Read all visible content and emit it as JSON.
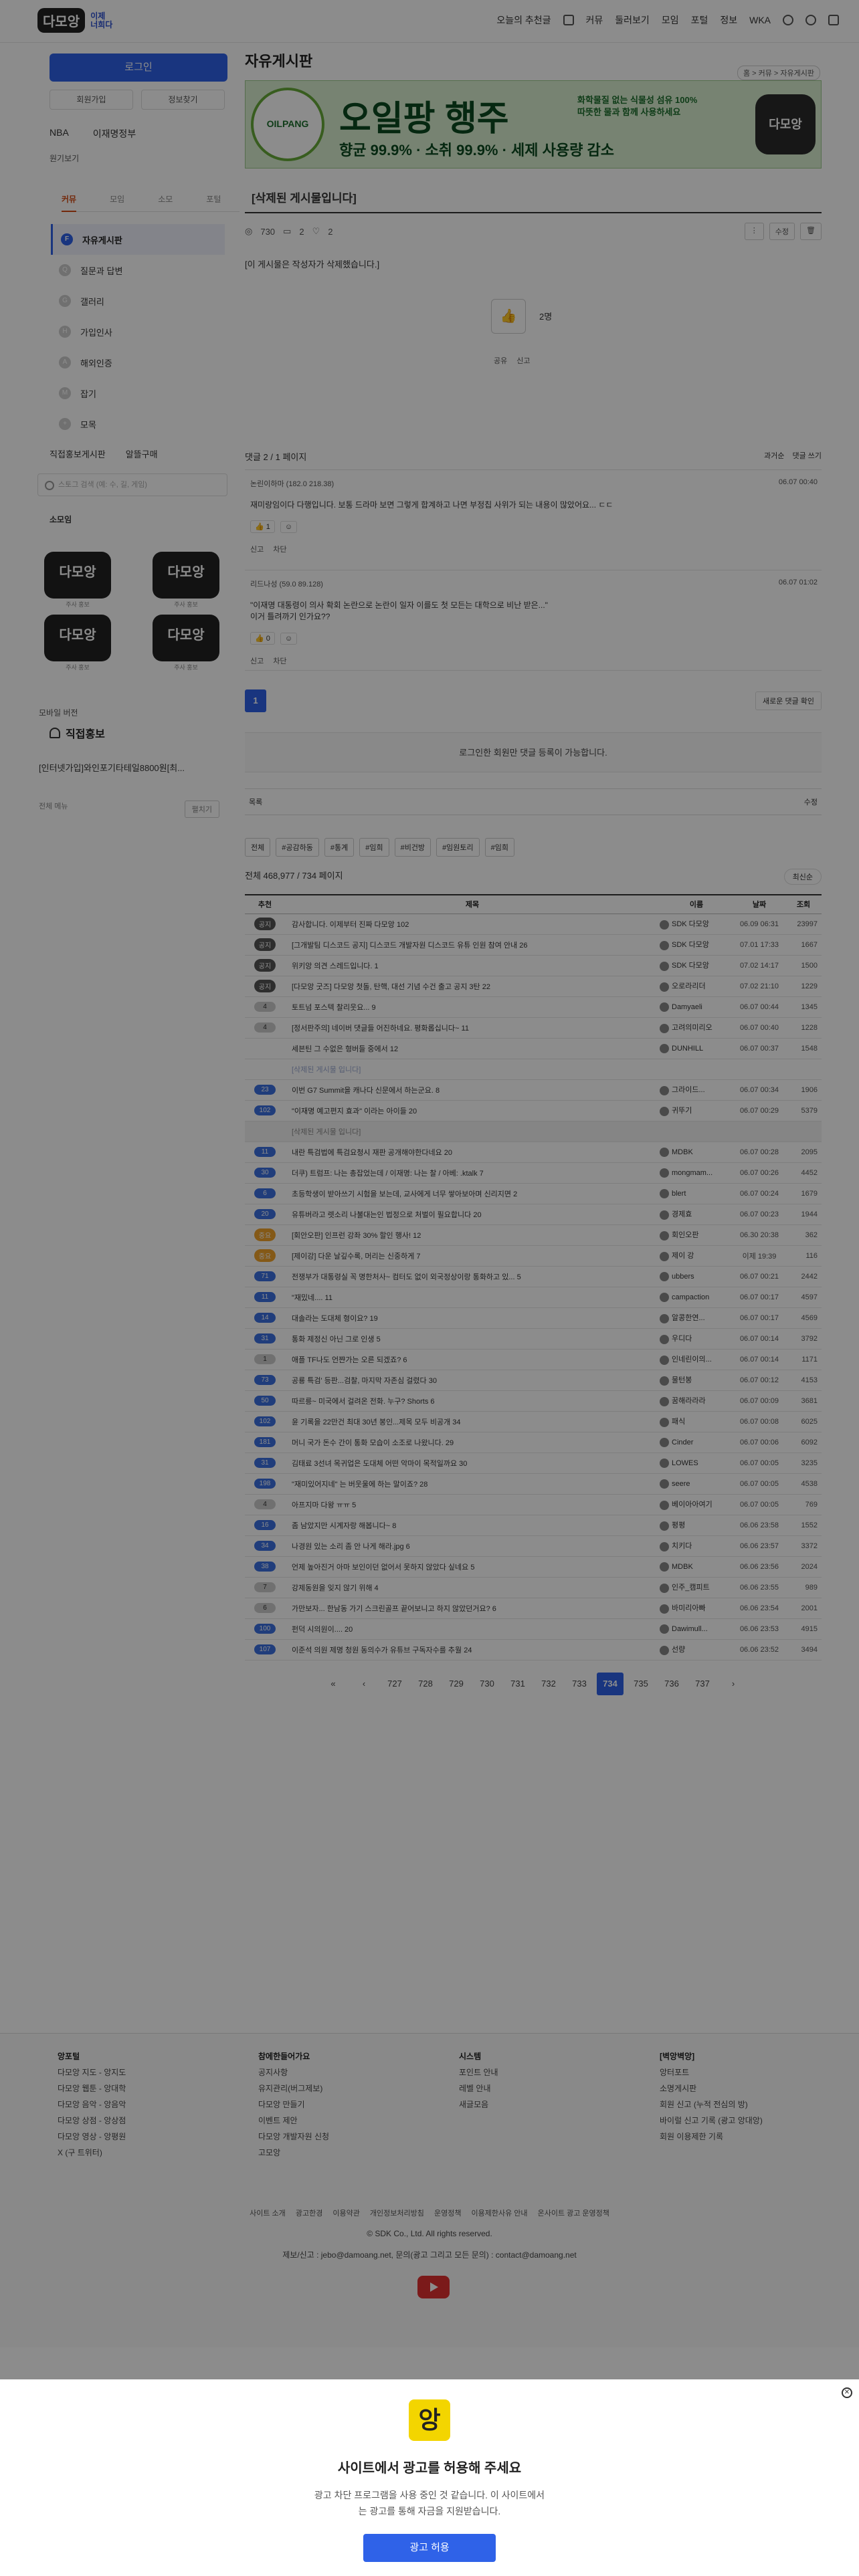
{
  "header": {
    "logo_text": "다모앙",
    "logo_sub": "이제\n너희다",
    "nav": [
      "오늘의 추천글",
      "커뮤",
      "둘러보기",
      "모임",
      "포털",
      "정보",
      "WKA"
    ]
  },
  "sidebar": {
    "login_label": "로그인",
    "join_label": "회원가입",
    "find_label": "정보찾기",
    "link1": "NBA",
    "link2": "이재명정부",
    "recent_label": "원기보기",
    "tabs": [
      "커뮤",
      "모임",
      "소모",
      "포털"
    ],
    "menu": [
      {
        "label": "자유게시판",
        "dot": "F"
      },
      {
        "label": "질문과 답변",
        "dot": "Q"
      },
      {
        "label": "갤러리",
        "dot": "G"
      },
      {
        "label": "가입인사",
        "dot": "H"
      },
      {
        "label": "해외인증",
        "dot": "A"
      },
      {
        "label": "잡기",
        "dot": "M"
      },
      {
        "label": "모목",
        "dot": "+"
      }
    ],
    "shop1": "직접홍보게시판",
    "shop2": "알뜰구매",
    "search_placeholder": "스토그 검색 (예: 수, 길, 게임)",
    "sub_label": "소모임",
    "stickers": [
      {
        "text": "다모앙",
        "cap": "주사 홍보"
      },
      {
        "text": "다모앙",
        "cap": "주사 홍보"
      },
      {
        "text": "다모앙",
        "cap": "주사 홍보"
      },
      {
        "text": "다모앙",
        "cap": "주사 홍보"
      }
    ],
    "mobile_label": "모바일 버전",
    "ad_title": "직접홍보",
    "ad_text": "[인터넷가입]와인포기타테일8800원[최...",
    "foot_left": "전체 메뉴",
    "foot_right": "펼치기"
  },
  "board": {
    "title": "자유게시판",
    "breadcrumb": "홈 > 커뮤 > 자유게시판",
    "banner": {
      "brand": "OILPANG",
      "headline": "오일팡 행주",
      "features": "향균 99.9% · 소취 99.9% · 세제 사용량 감소",
      "note": "화학물질 없는 식물성 섬유 100%\n따뜻한 물과 함께 사용하세요",
      "logo2": "다모앙"
    },
    "post_title": "[삭제된 게시물입니다]",
    "views": "730",
    "comments": "2",
    "likes": "2",
    "edit_label": "수정",
    "body": "[이 게시물은 작성자가 삭제했습니다.]",
    "vote_count": "2명",
    "share_label": "공유",
    "report_label": "신고"
  },
  "comments": {
    "header": "댓글 2 / 1 페이지",
    "sort_label": "과거순",
    "write_label": "댓글 쓰기",
    "items": [
      {
        "who": "논린이하마 (182.0 218.38)",
        "time": "06.07 00:40",
        "text": "재미랑임이다 다행입니다. 보통 드라마 보면 그렇게 합계하고 나면 부정칩 사위가 되는 내용이 많았어요... ㄷㄷ",
        "likes": "1",
        "report": "신고",
        "block": "차단"
      },
      {
        "who": "리드나성 (59.0 89.128)",
        "time": "06.07 01:02",
        "text": "\"이재명 대통령이 의사 확회 논란으로 논란이 일자 이를도 첫 모든는 대학으로 비난 받은...\"\n이거 틀려까기 인가요??",
        "likes": "0",
        "report": "신고",
        "block": "차단"
      }
    ],
    "page": "1",
    "new_check": "새로운 댓글 확인",
    "login_required": "로그인한 회원만 댓글 등록이 가능합니다."
  },
  "list": {
    "list_label": "목록",
    "chips": [
      "전체",
      "#공감하동",
      "#통계",
      "#임희",
      "#비건방",
      "#임원토리",
      "#임희"
    ],
    "total": "전체 468,977 / 734 페이지",
    "sort_label": "최신순",
    "columns": [
      "추천",
      "제목",
      "이름",
      "날짜",
      "조회"
    ],
    "rows": [
      {
        "num": "공지",
        "type": "notice",
        "title": "감사합니다. 이제부터 진짜 다모앙 102",
        "name": "SDK 다모앙",
        "date": "06.09 06:31",
        "view": "23997"
      },
      {
        "num": "공지",
        "type": "notice",
        "title": "[그개발팀 디스코드 공지] 디스코드 개발자원 디스코드 유튜 인원 참여 안내 26",
        "name": "SDK 다모앙",
        "date": "07.01 17:33",
        "view": "1667"
      },
      {
        "num": "공지",
        "type": "notice",
        "title": "위키앙 의견 스레드입니다. 1",
        "name": "SDK 다모앙",
        "date": "07.02 14:17",
        "view": "1500"
      },
      {
        "num": "공지",
        "type": "notice",
        "title": "[다모앙 굿즈] 다모앙 첫돌, 탄핵, 대선 기념 수건 출고 공지 3탄 22",
        "name": "오로라리더",
        "date": "07.02 21:10",
        "view": "1229"
      },
      {
        "num": "4",
        "type": "gray",
        "title": "토트넘 포스텍 찰리웃요... 9",
        "name": "Damyaeli",
        "date": "06.07 00:44",
        "view": "1345"
      },
      {
        "num": "4",
        "type": "gray",
        "title": "[정서판주의] 네이버 댓글들 어진하네요. 평화롭십니다~ 11",
        "name": "고려의미리오",
        "date": "06.07 00:40",
        "view": "1228"
      },
      {
        "num": "",
        "type": "gray",
        "title": "세븐틴 그 수없은 형버들 중에서 12",
        "name": "DUNHILL",
        "date": "06.07 00:37",
        "view": "1548"
      },
      {
        "num": "",
        "type": "deleted",
        "title": "[삭제된 게시물 입니다]",
        "name": "",
        "date": "",
        "view": ""
      },
      {
        "num": "23",
        "type": "blue",
        "title": "이번 G7 Summit을 캐나다 신문에서 하는군요. 8",
        "name": "그라이드...",
        "date": "06.07 00:34",
        "view": "1906"
      },
      {
        "num": "102",
        "type": "blue",
        "title": "\"이재명 예고편지 효과\" 이라는 아이들 20",
        "name": "귀뚜기",
        "date": "06.07 00:29",
        "view": "5379"
      },
      {
        "num": "",
        "type": "sep",
        "title": "[삭제된 게시물 입니다]",
        "name": "",
        "date": "",
        "view": ""
      },
      {
        "num": "11",
        "type": "blue",
        "title": "내란 특검법에 특검요청시 재판 공개해야한다네요 20",
        "name": "MDBK",
        "date": "06.07 00:28",
        "view": "2095"
      },
      {
        "num": "30",
        "type": "blue",
        "title": "더쿠) 트럼프: 나는 총잡었는데 / 이재명: 나는 찰 / 아베: .ktalk 7",
        "name": "mongmam...",
        "date": "06.07 00:26",
        "view": "4452"
      },
      {
        "num": "6",
        "type": "blue",
        "title": "초등학생이 받아쓰기 시험을 보는데, 교사에게 너무 쌓아보아며 신리지면 2",
        "name": "blert",
        "date": "06.07 00:24",
        "view": "1679"
      },
      {
        "num": "20",
        "type": "blue",
        "title": "유튜버라고 렛소리 나불대는인 법정으로 처벌이 필요합니다 20",
        "name": "경제효",
        "date": "06.07 00:23",
        "view": "1944"
      },
      {
        "num": "중요",
        "type": "orange",
        "title": "[회안오판] 인프런 강좌 30% 할인 행사! 12",
        "name": "회인오판",
        "date": "06.30 20:38",
        "view": "362"
      },
      {
        "num": "중요",
        "type": "orange",
        "title": "[제이강] 다운 날깊수록, 머리는 신중하게 7",
        "name": "제이 강",
        "date": "이제 19:39",
        "view": "116"
      },
      {
        "num": "71",
        "type": "blue",
        "title": "전쟁부가 대통령실 꼭 명한처사~ 컴터도 없이 외국정상이랑 통화하고 있... 5",
        "name": "ubbers",
        "date": "06.07 00:21",
        "view": "2442"
      },
      {
        "num": "11",
        "type": "blue",
        "title": "\"재밌네.... 11",
        "name": "campaction",
        "date": "06.07 00:17",
        "view": "4597"
      },
      {
        "num": "14",
        "type": "blue",
        "title": "대솔라는 도대체 형이요? 19",
        "name": "알콩한연...",
        "date": "06.07 00:17",
        "view": "4569"
      },
      {
        "num": "31",
        "type": "blue",
        "title": "통화 제정신 아닌 그로 인생 5",
        "name": "우디다",
        "date": "06.07 00:14",
        "view": "3792"
      },
      {
        "num": "1",
        "type": "gray",
        "title": "애플 TF나도 언쨘가는 오른 되겠죠? 6",
        "name": "인네린이의...",
        "date": "06.07 00:14",
        "view": "1171"
      },
      {
        "num": "73",
        "type": "blue",
        "title": "공룡 특검' 등판...검찰, 마지막 자존심 걸렸다 30",
        "name": "물턴봉",
        "date": "06.07 00:12",
        "view": "4153"
      },
      {
        "num": "50",
        "type": "blue",
        "title": "따르릉~ 미국에서 걸려온 전화. 누구? Shorts 6",
        "name": "꿈해라라라",
        "date": "06.07 00:09",
        "view": "3681"
      },
      {
        "num": "102",
        "type": "blue",
        "title": "윤 기록을 22만건 최대 30년 봉인...제목 모두 비공개 34",
        "name": "패식",
        "date": "06.07 00:08",
        "view": "6025"
      },
      {
        "num": "181",
        "type": "blue",
        "title": "머니 국가 돈수 간이 통화 모습이 소조로 나왔니다. 29",
        "name": "Cinder",
        "date": "06.07 00:06",
        "view": "6092"
      },
      {
        "num": "31",
        "type": "blue",
        "title": "김태료 3선녀 목귀업은 도대체 어떤 악마이 목적일까요 30",
        "name": "LOWES",
        "date": "06.07 00:05",
        "view": "3235"
      },
      {
        "num": "198",
        "type": "blue",
        "title": "\"재미있어지네\" 는 버웃울에 하는 말이죠? 28",
        "name": "seere",
        "date": "06.07 00:05",
        "view": "4538"
      },
      {
        "num": "4",
        "type": "gray",
        "title": "아프지마 다왕 ㅠㅠ 5",
        "name": "베이아아여기",
        "date": "06.07 00:05",
        "view": "769"
      },
      {
        "num": "16",
        "type": "blue",
        "title": "좀 남았지만 시계자랑 해봅니다~ 8",
        "name": "평평",
        "date": "06.06 23:58",
        "view": "1552"
      },
      {
        "num": "34",
        "type": "blue",
        "title": "나경원 있는 소리 좀 안 나게 해라.jpg 6",
        "name": "치키다",
        "date": "06.06 23:57",
        "view": "3372"
      },
      {
        "num": "38",
        "type": "blue",
        "title": "언제 높아진거 아마 보인이던 없어서 못하지 않았다 싶네요 5",
        "name": "MDBK",
        "date": "06.06 23:56",
        "view": "2024"
      },
      {
        "num": "7",
        "type": "gray",
        "title": "강제동원을 잊지 않기 위해 4",
        "name": "인주_캠피트",
        "date": "06.06 23:55",
        "view": "989"
      },
      {
        "num": "6",
        "type": "gray",
        "title": "가만보자... 한남동 가기 스크린골프 끝어보니고 하지 않았던거요? 6",
        "name": "바미리아빠",
        "date": "06.06 23:54",
        "view": "2001"
      },
      {
        "num": "100",
        "type": "blue",
        "title": "펀덕 시의원이.... 20",
        "name": "Dawimull...",
        "date": "06.06 23:53",
        "view": "4915"
      },
      {
        "num": "107",
        "type": "blue",
        "title": "이준석 의원 제명 청원 동의수가 유튜브 구독자수를 추월 24",
        "name": "선량",
        "date": "06.06 23:52",
        "view": "3494"
      }
    ],
    "pages": [
      "«",
      "‹",
      "727",
      "728",
      "729",
      "730",
      "731",
      "732",
      "733",
      "734",
      "735",
      "736",
      "737",
      "›"
    ],
    "active_page": "734"
  },
  "footer": {
    "col1_title": "앙포털",
    "col1": [
      "다모앙 지도 - 앙지도",
      "다모앙 웹툰 - 앙대학",
      "다모앙 음악 - 앙음악",
      "다모앙 상점 - 앙상점",
      "다모앙 영상 - 앙평원",
      "X (구 트위터)"
    ],
    "col2_title": "참에한들어가요",
    "col2": [
      "공지사항",
      "유지관리(버그제보)",
      "다모앙 만들기",
      "이벤트 제안",
      "다모앙 개발자원 신청",
      "고모앙"
    ],
    "col3_title": "시스템",
    "col3": [
      "포인트 안내",
      "레벨 안내",
      "새글모음"
    ],
    "col4_title": "[벽앙벽앙]",
    "col4": [
      "앙터포트",
      "소명게시판",
      "회원 신고 (누적 전심의 방)",
      "바이럴 신고 기록 (광고 앙대앙)",
      "회원 이용제한 기록"
    ],
    "links": [
      "사이트 소개",
      "광고한경",
      "이용약관",
      "개인정보처리방침",
      "운영정책",
      "이용제한사유 안내",
      "온사이트 광고 운영정책"
    ],
    "copyright": "© SDK Co., Ltd. All rights reserved.",
    "contact": "제보/신고 : jebo@damoang.net, 문의(광고 그리고 모든 문의) : contact@damoang.net"
  },
  "modal": {
    "icon": "앙",
    "title": "사이트에서 광고를 허용해 주세요",
    "text": "광고 차단 프로그램을 사용 중인 것 같습니다. 이 사이트에서\n는 광고를 통해 자금을 지원받습니다.",
    "button": "광고 허용"
  }
}
